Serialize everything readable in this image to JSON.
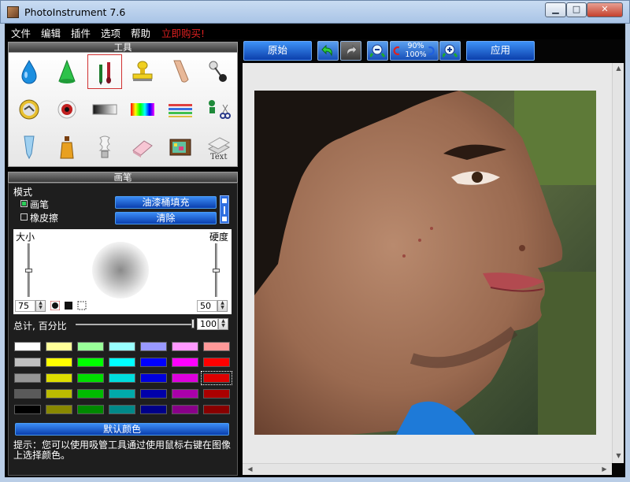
{
  "window": {
    "title": "PhotoInstrument 7.6",
    "controls": {
      "minimize": "▁",
      "maximize": "□",
      "close": "✕"
    }
  },
  "menu": {
    "items": [
      "文件",
      "编辑",
      "插件",
      "选项",
      "帮助"
    ],
    "buy": "立即购买!"
  },
  "tools": {
    "title": "工具",
    "items": [
      {
        "name": "drop-tool-icon"
      },
      {
        "name": "cone-tool-icon"
      },
      {
        "name": "brush-tool-icon",
        "selected": true
      },
      {
        "name": "stamp-tool-icon"
      },
      {
        "name": "smudge-tool-icon"
      },
      {
        "name": "pin-tool-icon"
      },
      {
        "name": "healing-tool-icon"
      },
      {
        "name": "eye-tool-icon"
      },
      {
        "name": "gradient-tool-icon"
      },
      {
        "name": "spectrum-tool-icon"
      },
      {
        "name": "color-lines-tool-icon"
      },
      {
        "name": "scissors-tool-icon"
      },
      {
        "name": "tube-tool-icon"
      },
      {
        "name": "bottle-tool-icon"
      },
      {
        "name": "bulb-tool-icon"
      },
      {
        "name": "eraser-tool-icon"
      },
      {
        "name": "tv-tool-icon"
      },
      {
        "name": "text-tool-icon"
      }
    ]
  },
  "brush": {
    "title": "画笔",
    "mode_label": "模式",
    "mode_brush": "画笔",
    "mode_eraser": "橡皮擦",
    "fill_button": "油漆桶填充",
    "clear_button": "清除",
    "size_label": "大小",
    "hardness_label": "硬度",
    "size_value": "75",
    "hardness_value": "50",
    "size_level": 0.5,
    "hardness_level": 0.5,
    "opacity_label": "总计, 百分比",
    "opacity_value": "100"
  },
  "palette": {
    "colors": [
      [
        "#ffffff",
        "#ffff99",
        "#99ff99",
        "#99ffff",
        "#9999ff",
        "#ff99ff",
        "#ff9999"
      ],
      [
        "#c0c0c0",
        "#ffff00",
        "#00ff00",
        "#00ffff",
        "#0000ff",
        "#ff00ff",
        "#ff0000"
      ],
      [
        "#969696",
        "#dddd00",
        "#00dd00",
        "#00dddd",
        "#0000dd",
        "#dd00dd",
        "#dd0000"
      ],
      [
        "#5a5a5a",
        "#bbbb00",
        "#00bb00",
        "#00aaaa",
        "#0000aa",
        "#aa00aa",
        "#aa0000"
      ],
      [
        "#000000",
        "#888800",
        "#008800",
        "#008888",
        "#000088",
        "#880088",
        "#880000"
      ]
    ],
    "selected": [
      2,
      6
    ],
    "default_button": "默认颜色"
  },
  "hint": "提示：您可以使用吸管工具通过使用鼠标右键在图像上选择颜色。",
  "toolbar": {
    "original": "原始",
    "apply": "应用",
    "zoom_top": "90%",
    "zoom_bottom": "100%"
  }
}
